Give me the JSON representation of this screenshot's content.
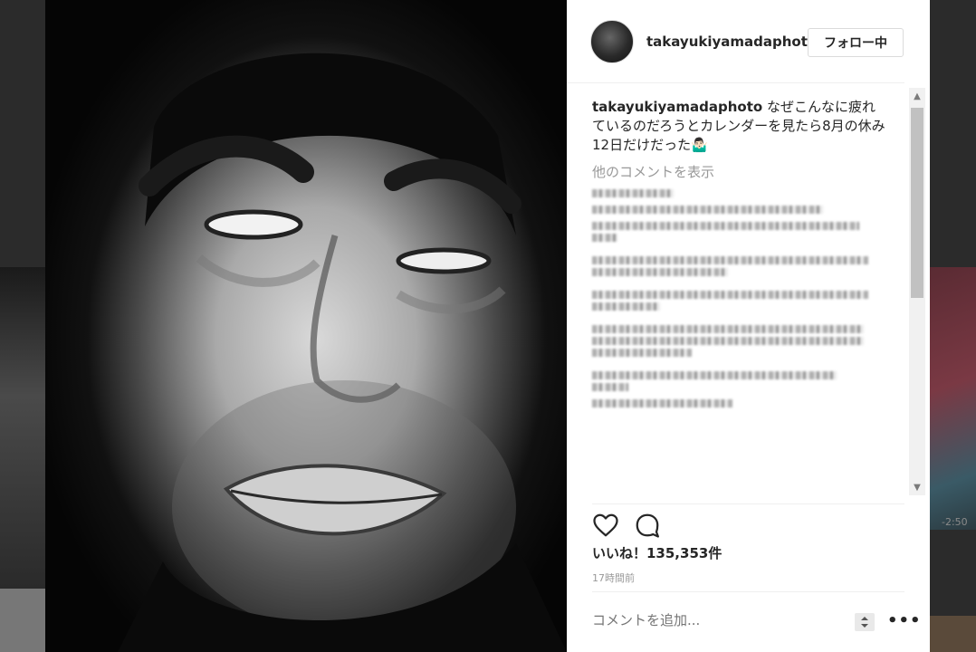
{
  "header": {
    "username": "takayukiyamadaphoto",
    "follow_label": "フォロー中"
  },
  "caption": {
    "username": "takayukiyamadaphoto",
    "text": "なぜこんなに疲れているのだろうとカレンダーを見たら8月の休み12日だけだった🤷🏻‍♂️"
  },
  "comments": {
    "more_label": "他のコメントを表示"
  },
  "likes_label": "いいね！135,353件",
  "time_label": "17時間前",
  "comment_input": {
    "placeholder": "コメントを追加..."
  },
  "more_options_label": "•••",
  "background_text": "-2:50",
  "icons": {
    "like": "heart-icon",
    "comment": "speech-bubble-icon",
    "options": "more-icon"
  },
  "colors": {
    "text": "#262626",
    "muted": "#999999",
    "border": "#dbdbdb"
  }
}
